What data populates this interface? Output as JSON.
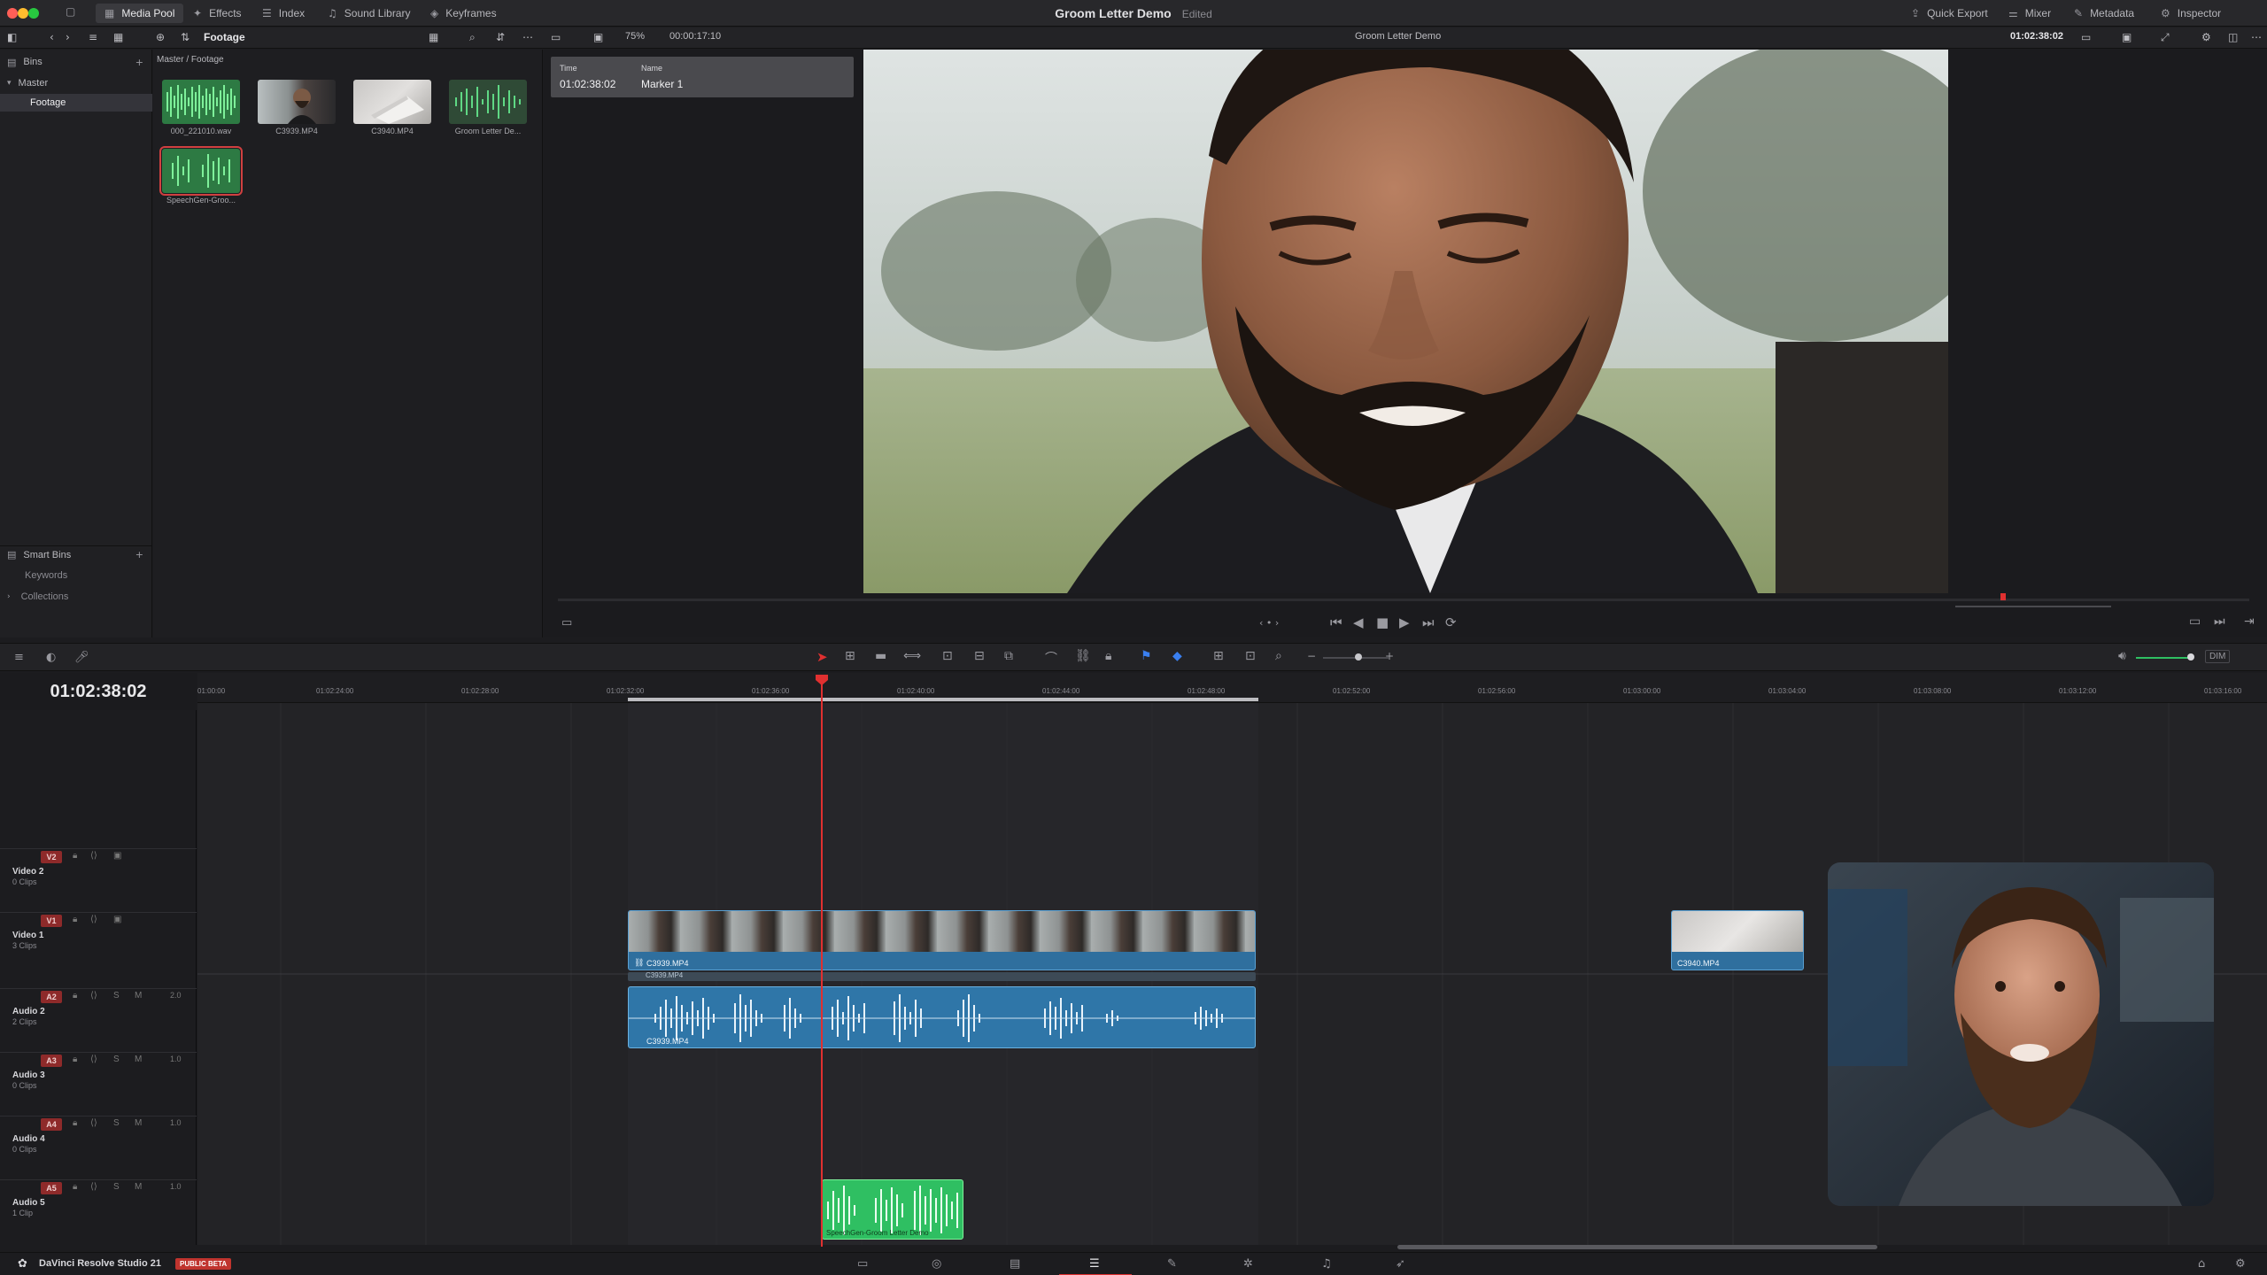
{
  "window": {
    "title": "Groom Letter Demo",
    "status": "Edited"
  },
  "topbar": {
    "media_pool": "Media Pool",
    "effects": "Effects",
    "index": "Index",
    "sound_library": "Sound Library",
    "keyframes": "Keyframes",
    "quick_export": "Quick Export",
    "mixer": "Mixer",
    "metadata": "Metadata",
    "inspector": "Inspector"
  },
  "toolbar2": {
    "bin_name": "Footage",
    "zoom": "75%",
    "duration": "00:00:17:10",
    "timeline_name": "Groom Letter Demo",
    "source_timecode": "01:02:38:02"
  },
  "bins": {
    "header": "Bins",
    "master": "Master",
    "footage": "Footage",
    "smart_bins": "Smart Bins",
    "keywords": "Keywords",
    "collections": "Collections"
  },
  "pool": {
    "breadcrumb": "Master / Footage",
    "clips": [
      {
        "name": "000_221010.wav",
        "kind": "audio"
      },
      {
        "name": "C3939.MP4",
        "kind": "video"
      },
      {
        "name": "C3940.MP4",
        "kind": "video"
      },
      {
        "name": "Groom Letter De...",
        "kind": "audio"
      },
      {
        "name": "SpeechGen-Groo...",
        "kind": "audio-selected"
      }
    ]
  },
  "marker": {
    "time_label": "Time",
    "time_value": "01:02:38:02",
    "name_label": "Name",
    "name_value": "Marker 1"
  },
  "timeline": {
    "timecode": "01:02:38:02",
    "ruler": [
      "01:00:00",
      "01:02:24:00",
      "01:02:28:00",
      "01:02:32:00",
      "01:02:36:00",
      "01:02:40:00",
      "01:02:44:00",
      "01:02:48:00",
      "01:02:52:00",
      "01:02:56:00",
      "01:03:00:00",
      "01:03:04:00",
      "01:03:08:00",
      "01:03:12:00",
      "01:03:16:00"
    ],
    "tracks": [
      {
        "badge": "V2",
        "name": "Video 2",
        "sub": "0 Clips",
        "level": ""
      },
      {
        "badge": "V1",
        "name": "Video 1",
        "sub": "3 Clips",
        "level": ""
      },
      {
        "badge": "A2",
        "name": "Audio 2",
        "sub": "2 Clips",
        "level": "2.0"
      },
      {
        "badge": "A3",
        "name": "Audio 3",
        "sub": "0 Clips",
        "level": "1.0"
      },
      {
        "badge": "A4",
        "name": "Audio 4",
        "sub": "0 Clips",
        "level": "1.0"
      },
      {
        "badge": "A5",
        "name": "Audio 5",
        "sub": "1 Clip",
        "level": "1.0"
      }
    ],
    "clips": {
      "v1_main": "C3939.MP4",
      "v1_tail": "C3940.MP4",
      "a2_top": "C3939.MP4",
      "a2_main": "C3939.MP4",
      "a5_speech": "SpeechGen-Groom Letter Demo"
    }
  },
  "footer": {
    "app": "DaVinci Resolve Studio 21",
    "beta": "PUBLIC BETA"
  },
  "colors": {
    "accent_red": "#e03030",
    "clip_blue": "#2f6f9e",
    "audio_green": "#2fbf62"
  }
}
